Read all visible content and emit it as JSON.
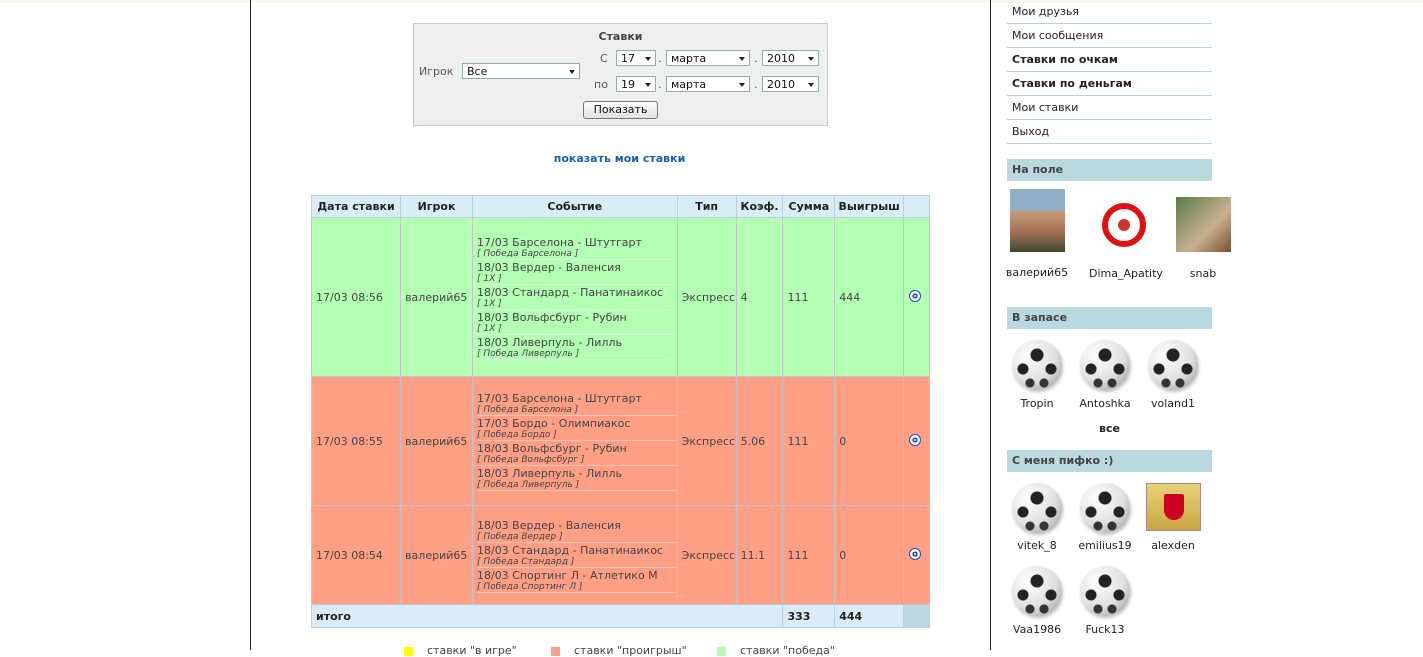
{
  "filter": {
    "title": "Ставки",
    "player_label": "Игрок",
    "player_value": "Все",
    "from_label": "С",
    "to_label": "по",
    "from_day": "17",
    "from_month": "марта",
    "from_year": "2010",
    "to_day": "19",
    "to_month": "марта",
    "to_year": "2010",
    "dot": ".",
    "show_button": "Показать"
  },
  "my_bets_link": "показать мои ставки",
  "table": {
    "headers": [
      "Дата ставки",
      "Игрок",
      "Событие",
      "Тип",
      "Коэф.",
      "Сумма",
      "Выигрыш"
    ],
    "rows": [
      {
        "status": "win",
        "date": "17/03 08:56",
        "player": "валерий65",
        "events": [
          {
            "name": "17/03 Барселона - Штутгарт",
            "outcome": "[ Победа Барселона ]"
          },
          {
            "name": "18/03 Вердер - Валенсия",
            "outcome": "[ 1X ]"
          },
          {
            "name": "18/03 Стандард - Панатинаикос",
            "outcome": "[ 1X ]"
          },
          {
            "name": "18/03 Вольфсбург - Рубин",
            "outcome": "[ 1X ]"
          },
          {
            "name": "18/03 Ливерпуль - Лилль",
            "outcome": "[ Победа Ливерпуль ]"
          }
        ],
        "type": "Экспресс",
        "coef": "4",
        "sum": "111",
        "win": "444"
      },
      {
        "status": "lose",
        "date": "17/03 08:55",
        "player": "валерий65",
        "events": [
          {
            "name": "17/03 Барселона - Штутгарт",
            "outcome": "[ Победа Барселона ]"
          },
          {
            "name": "17/03 Бордо - Олимпиакос",
            "outcome": "[ Победа Бордо ]"
          },
          {
            "name": "18/03 Вольфсбург - Рубин",
            "outcome": "[ Победа Вольфсбург ]"
          },
          {
            "name": "18/03 Ливерпуль - Лилль",
            "outcome": "[ Победа Ливерпуль ]"
          }
        ],
        "type": "Экспресс",
        "coef": "5.06",
        "sum": "111",
        "win": "0"
      },
      {
        "status": "lose",
        "date": "17/03 08:54",
        "player": "валерий65",
        "events": [
          {
            "name": "18/03 Вердер - Валенсия",
            "outcome": "[ Победа Вердер ]"
          },
          {
            "name": "18/03 Стандард - Панатинаикос",
            "outcome": "[ Победа Стандард ]"
          },
          {
            "name": "18/03 Спортинг Л - Атлетико М",
            "outcome": "[ Победа Спортинг Л ]"
          }
        ],
        "type": "Экспресс",
        "coef": "11.1",
        "sum": "111",
        "win": "0"
      }
    ],
    "total_label": "итого",
    "total_sum": "333",
    "total_win": "444"
  },
  "legend": [
    {
      "label": "ставки \"в игре\"",
      "color": "#ffff00"
    },
    {
      "label": "ставки \"проигрыш\"",
      "color": "#ff9f85"
    },
    {
      "label": "ставки \"победа\"",
      "color": "#b3ffb3"
    }
  ],
  "menu": [
    {
      "label": "Мои друзья",
      "bold": false
    },
    {
      "label": "Мои сообщения",
      "bold": false
    },
    {
      "label": "Ставки по очкам",
      "bold": true
    },
    {
      "label": "Ставки по деньгам",
      "bold": true
    },
    {
      "label": "Мои ставки",
      "bold": false
    },
    {
      "label": "Выход",
      "bold": false
    }
  ],
  "sections": {
    "on_field": "На поле",
    "reserve": "В запасе",
    "followers": "С меня пифко :)"
  },
  "on_field": [
    "валерий65",
    "Dima_Apatity",
    "snab"
  ],
  "reserve": [
    "Tropin",
    "Antoshka",
    "voland1"
  ],
  "all_link": "все",
  "followers": [
    "vitek_8",
    "emilius19",
    "alexden",
    "Vaa1986",
    "Fuck13"
  ]
}
